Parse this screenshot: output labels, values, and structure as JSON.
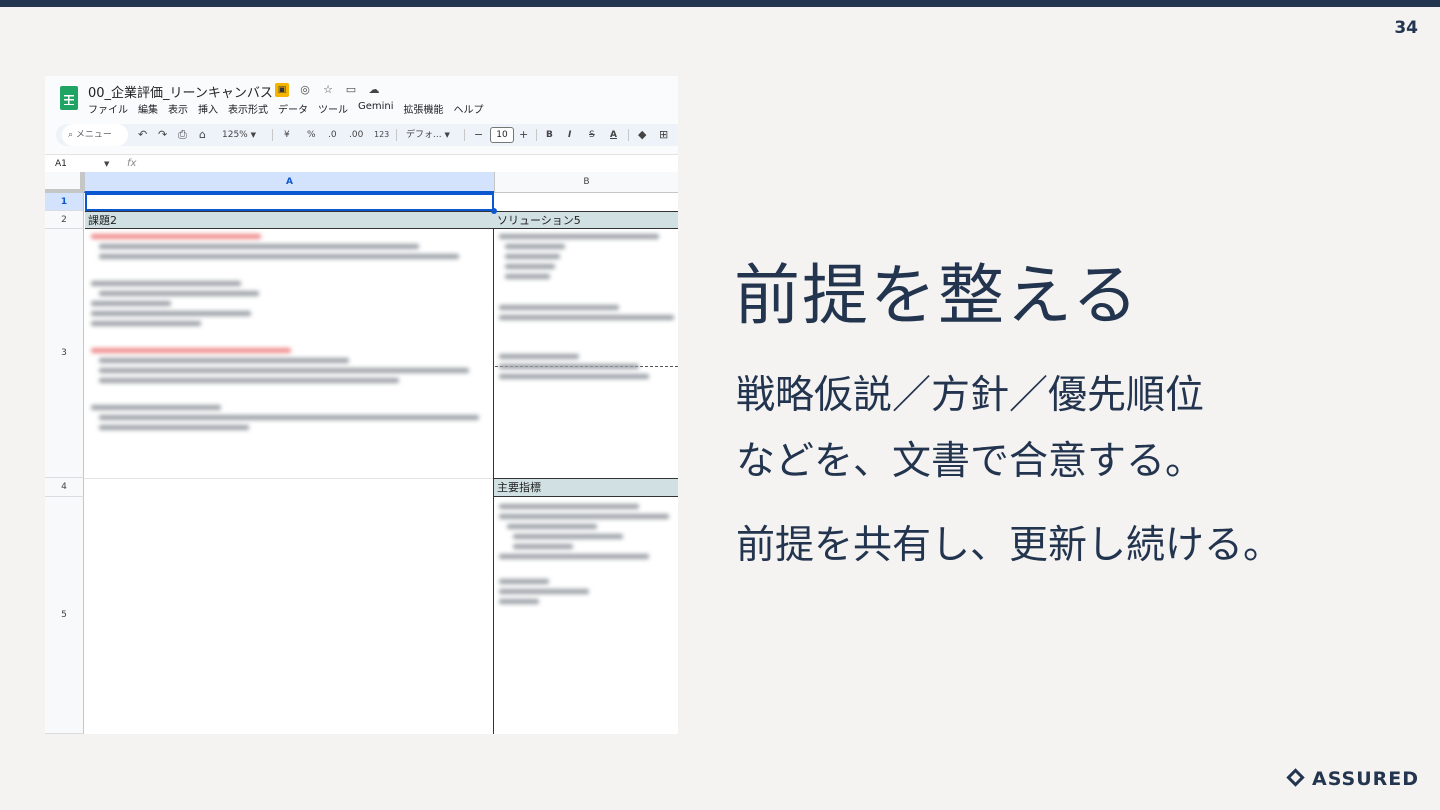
{
  "slide": {
    "page_number": "34",
    "headline": "前提を整える",
    "body_lines": [
      "戦略仮説／方針／優先順位",
      "などを、文書で合意する。",
      "前提を共有し、更新し続ける。"
    ],
    "logo_text": "ASSURED",
    "colors": {
      "primary": "#243550",
      "background": "#f4f3f1"
    }
  },
  "spreadsheet": {
    "title": "00_企業評価_リーンキャンバス",
    "title_icons": [
      "slides-icon",
      "shield-icon",
      "star-icon",
      "folder-icon",
      "cloud-icon"
    ],
    "menu": [
      "ファイル",
      "編集",
      "表示",
      "挿入",
      "表示形式",
      "データ",
      "ツール",
      "Gemini",
      "拡張機能",
      "ヘルプ"
    ],
    "toolbar": {
      "search": "メニュー",
      "zoom": "125%",
      "currency": "¥",
      "percent": "%",
      "dec_decrease": ".0",
      "dec_increase": ".00",
      "number_format": "123",
      "font": "デフォ...",
      "minus": "−",
      "font_size": "10",
      "plus": "+",
      "bold": "B",
      "italic": "I",
      "strike": "S",
      "text_color": "A"
    },
    "cell_ref": "A1",
    "fx": "fx",
    "columns": [
      "A",
      "B"
    ],
    "rows": [
      "1",
      "2",
      "3",
      "4",
      "5"
    ],
    "cells": {
      "a2": "課題2",
      "b2": "ソリューション5",
      "b4": "主要指標"
    }
  }
}
